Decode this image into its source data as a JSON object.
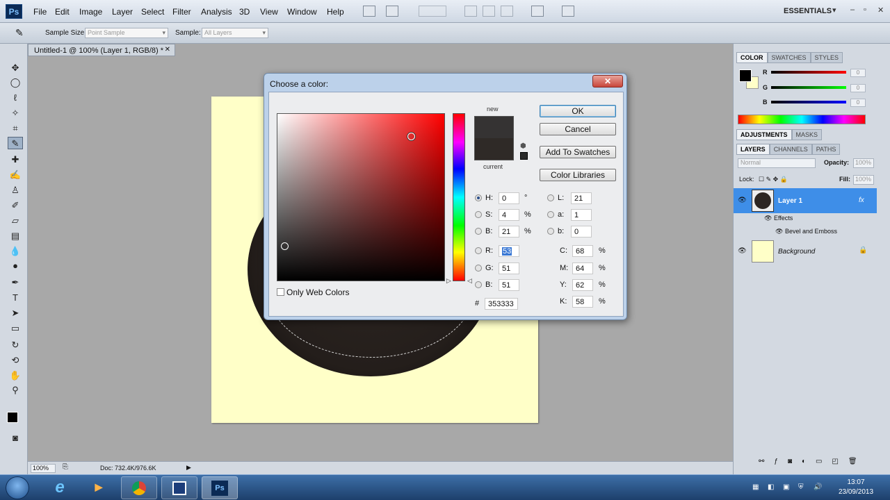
{
  "menubar": {
    "logo": "Ps",
    "items": [
      "File",
      "Edit",
      "Image",
      "Layer",
      "Select",
      "Filter",
      "Analysis",
      "3D",
      "View",
      "Window",
      "Help"
    ],
    "workspace": "ESSENTIALS",
    "workspace_arrow": "▾",
    "win_min": "–",
    "win_restore": "▫",
    "win_close": "✕"
  },
  "options": {
    "sample_size_label": "Sample Size:",
    "sample_size_value": "Point Sample",
    "sample_label": "Sample:",
    "sample_value": "All Layers"
  },
  "document": {
    "tab_title": "Untitled-1 @ 100% (Layer 1, RGB/8) *",
    "tab_close": "✕",
    "zoom": "100%",
    "doc_info": "Doc: 732.4K/976.6K"
  },
  "dialog": {
    "title": "Choose a color:",
    "close": "✕",
    "label_new": "new",
    "label_current": "current",
    "ok": "OK",
    "cancel": "Cancel",
    "add_to_swatches": "Add To Swatches",
    "color_libraries": "Color Libraries",
    "only_web_colors": "Only Web Colors",
    "new_color": "#353333",
    "current_color": "#2f2a27",
    "fields": {
      "H": {
        "label": "H:",
        "value": "0",
        "unit": "°"
      },
      "S": {
        "label": "S:",
        "value": "4",
        "unit": "%"
      },
      "Bv": {
        "label": "B:",
        "value": "21",
        "unit": "%"
      },
      "R": {
        "label": "R:",
        "value": "53"
      },
      "G": {
        "label": "G:",
        "value": "51"
      },
      "Bb": {
        "label": "B:",
        "value": "51"
      },
      "L": {
        "label": "L:",
        "value": "21"
      },
      "a": {
        "label": "a:",
        "value": "1"
      },
      "b": {
        "label": "b:",
        "value": "0"
      },
      "C": {
        "label": "C:",
        "value": "68",
        "unit": "%"
      },
      "M": {
        "label": "M:",
        "value": "64",
        "unit": "%"
      },
      "Y": {
        "label": "Y:",
        "value": "62",
        "unit": "%"
      },
      "K": {
        "label": "K:",
        "value": "58",
        "unit": "%"
      }
    },
    "hex_label": "#",
    "hex_value": "353333"
  },
  "panels": {
    "color_tabs": [
      "COLOR",
      "SWATCHES",
      "STYLES"
    ],
    "sliders": [
      {
        "label": "R",
        "value": "0"
      },
      {
        "label": "G",
        "value": "0"
      },
      {
        "label": "B",
        "value": "0"
      }
    ],
    "adjust_tabs": [
      "ADJUSTMENTS",
      "MASKS"
    ],
    "layer_tabs": [
      "LAYERS",
      "CHANNELS",
      "PATHS"
    ],
    "blend_mode": "Normal",
    "opacity_label": "Opacity:",
    "opacity_value": "100%",
    "lock_label": "Lock:",
    "fill_label": "Fill:",
    "fill_value": "100%",
    "layers": [
      {
        "name": "Layer 1",
        "fx": "fx"
      },
      {
        "name": "Effects"
      },
      {
        "name": "Bevel and Emboss"
      },
      {
        "name": "Background"
      }
    ]
  },
  "taskbar": {
    "ps_label": "Ps",
    "time": "13:07",
    "date": "23/09/2013"
  }
}
